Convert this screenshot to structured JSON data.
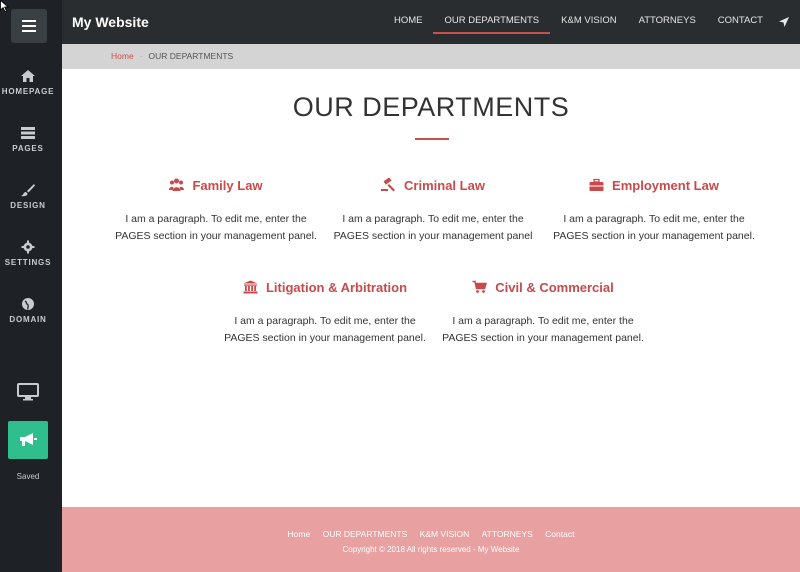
{
  "editor": {
    "items": [
      {
        "label": "HOMEPAGE",
        "icon": "home-icon"
      },
      {
        "label": "PAGES",
        "icon": "pages-icon"
      },
      {
        "label": "DESIGN",
        "icon": "brush-icon"
      },
      {
        "label": "SETTINGS",
        "icon": "gear-icon"
      },
      {
        "label": "DOMAIN",
        "icon": "globe-icon"
      }
    ],
    "saved_label": "Saved"
  },
  "site": {
    "brand": "My Website",
    "nav": [
      "HOME",
      "OUR DEPARTMENTS",
      "K&M VISION",
      "ATTORNEYS",
      "CONTACT"
    ],
    "breadcrumb": {
      "home": "Home",
      "current": "OUR DEPARTMENTS"
    },
    "title": "OUR DEPARTMENTS",
    "departments": [
      {
        "name": "Family Law",
        "icon": "people-icon",
        "text1": "I am a paragraph. To edit me, enter the",
        "text2": "PAGES section in your management panel."
      },
      {
        "name": "Criminal Law",
        "icon": "gavel-icon",
        "text1": "I am a paragraph. To edit me, enter the",
        "text2": "PAGES section in your management panel"
      },
      {
        "name": "Employment Law",
        "icon": "briefcase-icon",
        "text1": "I am a paragraph. To edit me, enter the",
        "text2": "PAGES section in your management panel."
      },
      {
        "name": "Litigation & Arbitration",
        "icon": "bank-icon",
        "text1": "I am a paragraph. To edit me, enter the",
        "text2": "PAGES section in your management panel."
      },
      {
        "name": "Civil & Commercial",
        "icon": "cart-icon",
        "text1": "I am a paragraph. To edit me, enter the",
        "text2": "PAGES section in your management panel."
      }
    ],
    "footer": {
      "links": [
        "Home",
        "OUR DEPARTMENTS",
        "K&M VISION",
        "ATTORNEYS",
        "Contact"
      ],
      "copyright": "Copyright © 2018 All rights reserved - My Website"
    }
  },
  "colors": {
    "accent": "#c9504f",
    "sidebar": "#1e2226",
    "topbar": "#2a2d30",
    "footer": "#e8a0a0",
    "publish": "#2fbf8f"
  }
}
